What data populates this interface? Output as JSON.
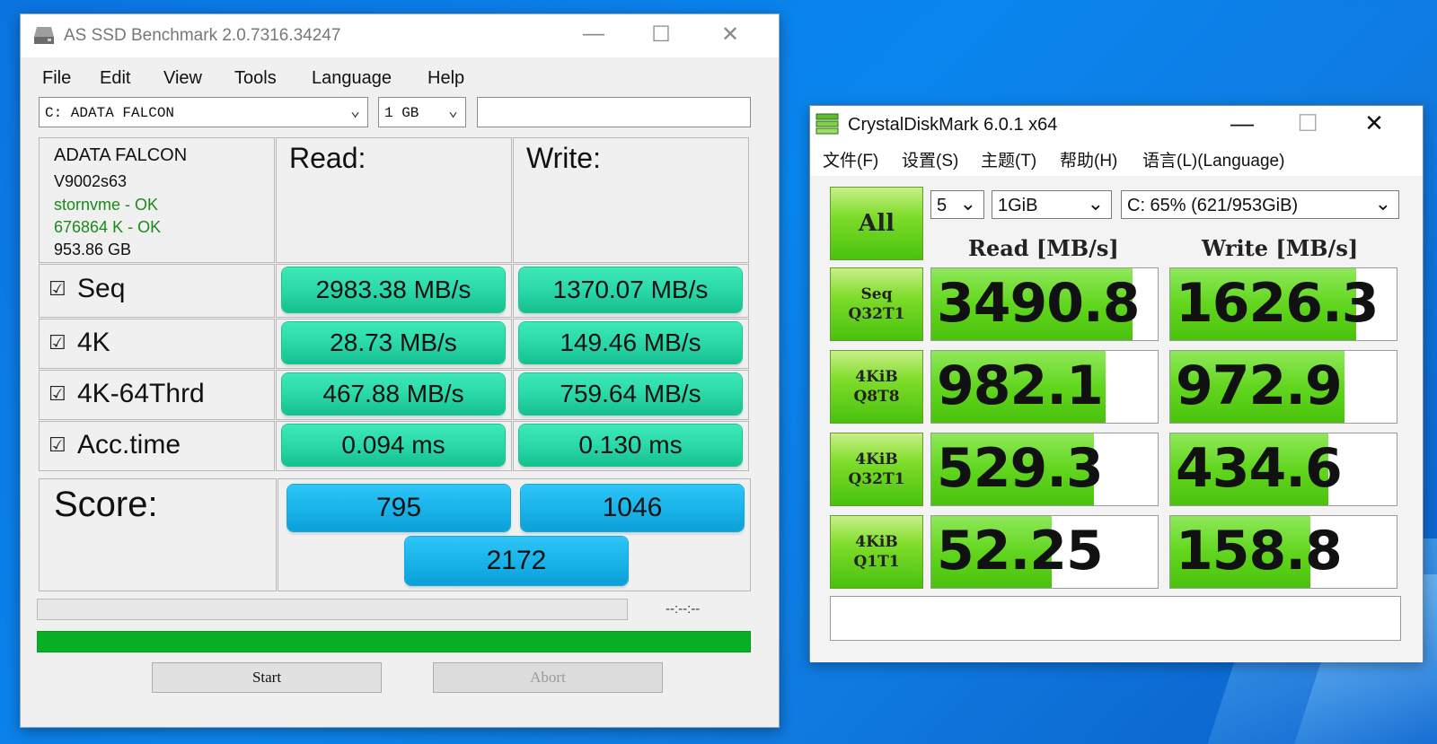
{
  "asssd": {
    "title": "AS SSD Benchmark 2.0.7316.34247",
    "menu": [
      "File",
      "Edit",
      "View",
      "Tools",
      "Language",
      "Help"
    ],
    "drive_select": "C: ADATA FALCON",
    "size_select": "1 GB",
    "info": {
      "model": "ADATA FALCON",
      "firmware": "V9002s63",
      "driver": "stornvme - OK",
      "alignment": "676864 K - OK",
      "capacity": "953.86 GB"
    },
    "read_header": "Read:",
    "write_header": "Write:",
    "rows": [
      {
        "label": "Seq",
        "read": "2983.38 MB/s",
        "write": "1370.07 MB/s"
      },
      {
        "label": "4K",
        "read": "28.73 MB/s",
        "write": "149.46 MB/s"
      },
      {
        "label": "4K-64Thrd",
        "read": "467.88 MB/s",
        "write": "759.64 MB/s"
      },
      {
        "label": "Acc.time",
        "read": "0.094 ms",
        "write": "0.130 ms"
      }
    ],
    "checkbox_glyph": "☑",
    "score_label": "Score:",
    "score_read": "795",
    "score_write": "1046",
    "score_total": "2172",
    "elapsed": "--:--:--",
    "overall_progress": 1.0,
    "start_label": "Start",
    "abort_label": "Abort"
  },
  "cdm": {
    "title": "CrystalDiskMark 6.0.1 x64",
    "menu": [
      "文件(F)",
      "设置(S)",
      "主题(T)",
      "帮助(H)",
      "语言(L)(Language)"
    ],
    "all_label": "All",
    "count_select": "5",
    "size_select": "1GiB",
    "drive_select": "C: 65% (621/953GiB)",
    "read_header": "Read [MB/s]",
    "write_header": "Write [MB/s]",
    "tests": [
      {
        "line1": "Seq",
        "line2": "Q32T1",
        "read": "3490.8",
        "write": "1626.3",
        "read_fill": 0.89,
        "write_fill": 0.82
      },
      {
        "line1": "4KiB",
        "line2": "Q8T8",
        "read": "982.1",
        "write": "972.9",
        "read_fill": 0.77,
        "write_fill": 0.77
      },
      {
        "line1": "4KiB",
        "line2": "Q32T1",
        "read": "529.3",
        "write": "434.6",
        "read_fill": 0.72,
        "write_fill": 0.7
      },
      {
        "line1": "4KiB",
        "line2": "Q1T1",
        "read": "52.25",
        "write": "158.8",
        "read_fill": 0.53,
        "write_fill": 0.62
      }
    ],
    "comment": ""
  },
  "colors": {
    "asssd_result": "#2bd9a8",
    "asssd_score": "#1ab4ea",
    "progress": "#06b025",
    "cdm_green": "#62d61e"
  }
}
